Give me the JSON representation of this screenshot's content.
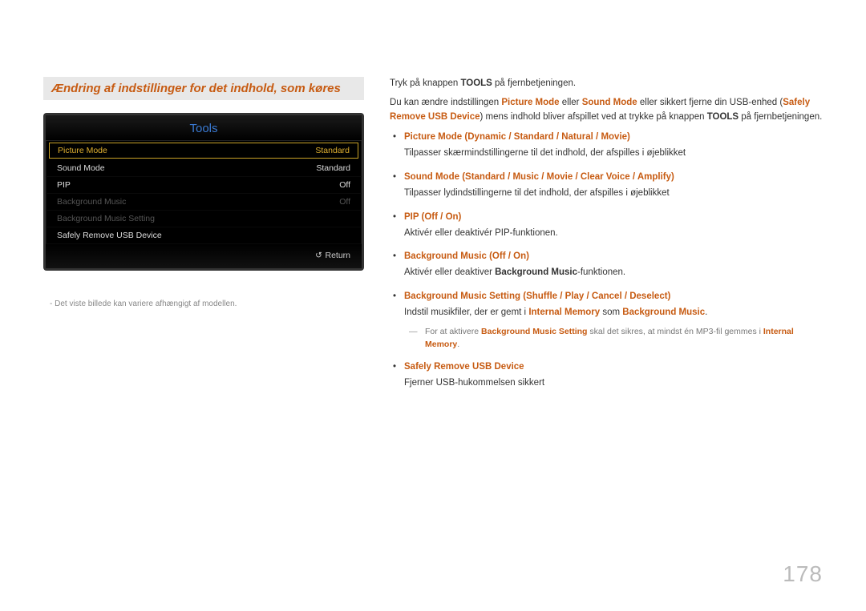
{
  "heading": "Ændring af indstillinger for det indhold, som køres",
  "tools": {
    "title": "Tools",
    "rows": [
      {
        "label": "Picture Mode",
        "value": "Standard",
        "state": "selected"
      },
      {
        "label": "Sound Mode",
        "value": "Standard",
        "state": "normal"
      },
      {
        "label": "PIP",
        "value": "Off",
        "state": "normal"
      },
      {
        "label": "Background Music",
        "value": "Off",
        "state": "dim"
      },
      {
        "label": "Background Music Setting",
        "value": "",
        "state": "dim"
      },
      {
        "label": "Safely Remove USB Device",
        "value": "",
        "state": "normal"
      }
    ],
    "return_label": "Return"
  },
  "footnote": "Det viste billede kan variere afhængigt af modellen.",
  "intro1_a": "Tryk på knappen ",
  "intro1_b": "TOOLS",
  "intro1_c": " på fjernbetjeningen.",
  "intro2_a": "Du kan ændre indstillingen ",
  "intro2_pm": "Picture Mode",
  "intro2_b": " eller ",
  "intro2_sm": "Sound Mode",
  "intro2_c": " eller sikkert fjerne din USB-enhed (",
  "intro2_sr": "Safely Remove USB Device",
  "intro2_d": ") mens indhold bliver afspillet ved at trykke på knappen ",
  "intro2_tools": "TOOLS",
  "intro2_e": " på fjernbetjeningen.",
  "options": [
    {
      "head_parts": [
        "Picture Mode",
        " (",
        "Dynamic",
        " / ",
        "Standard",
        " / ",
        "Natural",
        " / ",
        "Movie",
        ")"
      ],
      "desc": "Tilpasser skærmindstillingerne til det indhold, der afspilles i øjeblikket"
    },
    {
      "head_parts": [
        "Sound Mode",
        " (",
        "Standard",
        " / ",
        "Music",
        " / ",
        "Movie",
        " / ",
        "Clear Voice",
        " / ",
        "Amplify",
        ")"
      ],
      "desc": "Tilpasser lydindstillingerne til det indhold, der afspilles i øjeblikket"
    },
    {
      "head_parts": [
        "PIP",
        " (",
        "Off",
        " / ",
        "On",
        ")"
      ],
      "desc": "Aktivér eller deaktivér PIP-funktionen."
    },
    {
      "head_parts": [
        "Background Music",
        " (",
        "Off",
        " / ",
        "On",
        ")"
      ],
      "desc_html": "Aktivér eller deaktiver <b>Background Music</b>-funktionen."
    },
    {
      "head_parts": [
        "Background Music Setting",
        " (",
        "Shuffle",
        " / ",
        "Play",
        " / ",
        "Cancel",
        " / ",
        "Deselect",
        ")"
      ],
      "desc_html": "Indstil musikfiler, der er gemt i <span class='accent'>Internal Memory</span> som <span class='accent'>Background Music</span>.",
      "subnote_html": "For at aktivere <span class='accent'>Background Music Setting</span> skal det sikres, at mindst én MP3-fil gemmes i <span class='accent'>Internal Memory</span>."
    },
    {
      "head_parts": [
        "Safely Remove USB Device"
      ],
      "desc": "Fjerner USB-hukommelsen sikkert"
    }
  ],
  "page_number": "178"
}
